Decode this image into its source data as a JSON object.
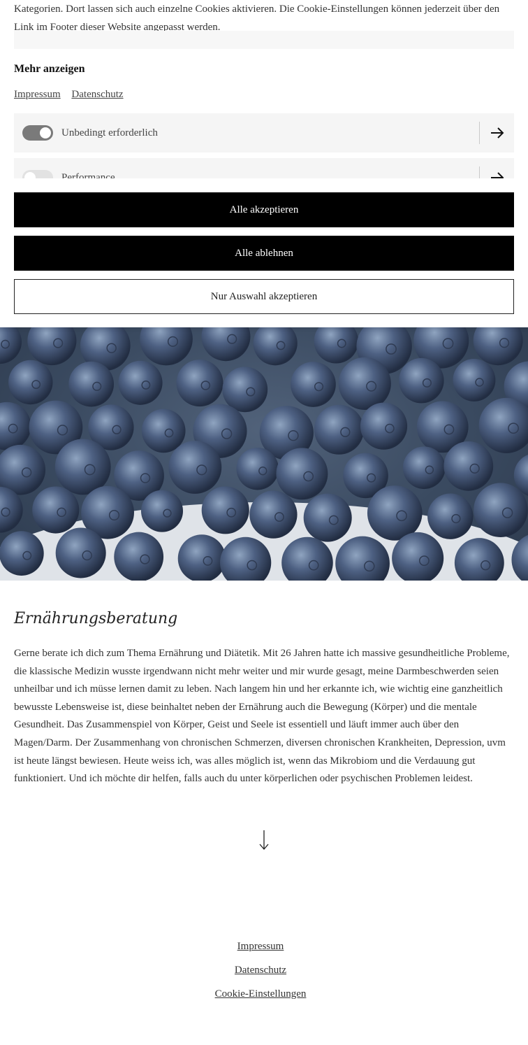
{
  "cookie": {
    "text": "Kategorien. Dort lassen sich auch einzelne Cookies aktivieren. Die Cookie-Einstellungen können jederzeit über den Link im Footer dieser Website angepasst werden.",
    "more_label": "Mehr anzeigen",
    "links": [
      "Impressum",
      "Datenschutz"
    ],
    "categories": [
      {
        "label": "Unbedingt erforderlich",
        "enabled": true
      },
      {
        "label": "Performance",
        "enabled": false
      }
    ],
    "accept_all": "Alle akzeptieren",
    "reject_all": "Alle ablehnen",
    "accept_selection": "Nur Auswahl akzeptieren"
  },
  "hero": {
    "icon": "blueberries-photo"
  },
  "section": {
    "title": "Ernährungsberatung",
    "body": "Gerne berate ich dich zum Thema Ernährung und Diätetik. Mit 26 Jahren hatte ich massive gesundheitliche Probleme, die klassische Medizin wusste irgendwann nicht mehr weiter und mir wurde gesagt, meine Darmbeschwerden seien unheilbar und ich müsse lernen damit zu leben. Nach langem hin und her erkannte ich, wie wichtig eine ganzheitlich bewusste Lebensweise ist, diese beinhaltet neben der Ernährung auch die Bewegung (Körper) und  die mentale Gesundheit. Das Zusammenspiel von Körper, Geist und Seele ist essentiell und läuft immer auch über den Magen/Darm. Der Zusammenhang von chronischen Schmerzen, diversen chronischen Krankheiten, Depression, uvm ist heute längst bewiesen. Heute weiss ich, was alles möglich ist, wenn das Mikrobiom und die Verdauung gut funktioniert. Und ich möchte dir helfen, falls auch du unter körperlichen oder psychischen Problemen leidest."
  },
  "footer": {
    "links": [
      "Impressum",
      "Datenschutz",
      "Cookie-Einstellungen"
    ]
  },
  "colors": {
    "button_dark": "#000000",
    "toggle_on": "#7a7a7a",
    "toggle_off": "#e2e2e2",
    "row_bg": "#f5f5f5"
  }
}
